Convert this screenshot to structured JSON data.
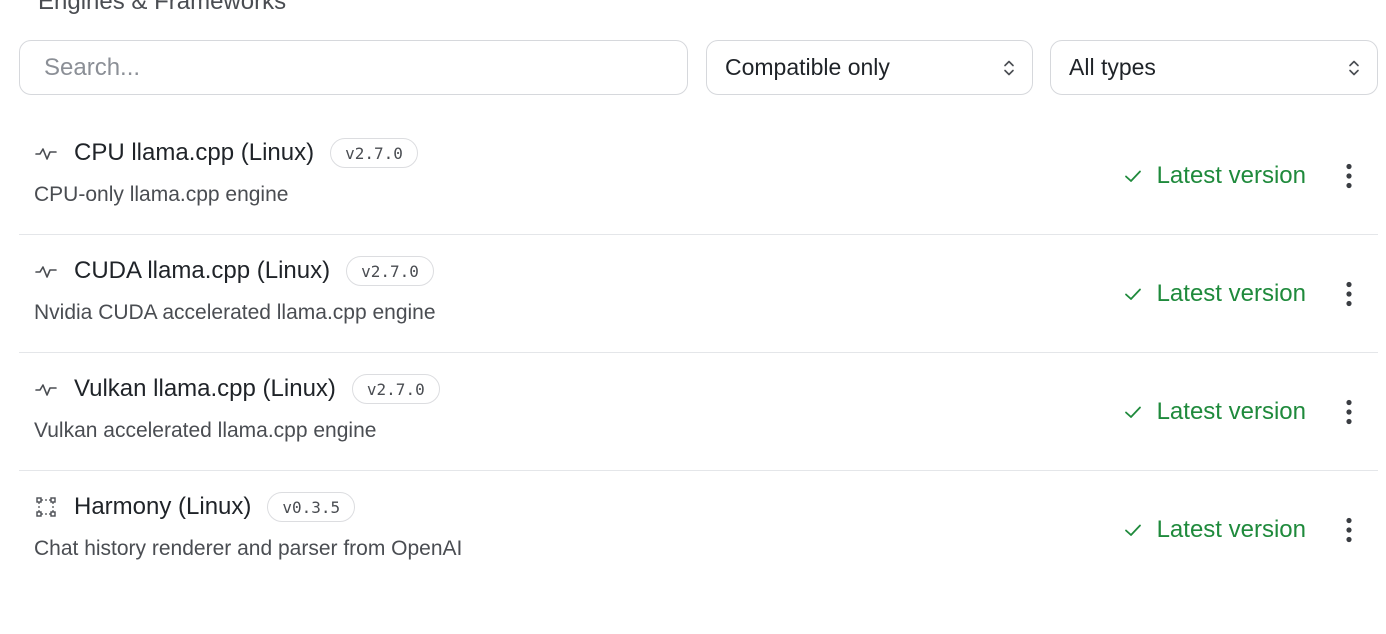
{
  "section_title": "Engines & Frameworks",
  "search": {
    "placeholder": "Search...",
    "value": ""
  },
  "filters": {
    "compatibility": {
      "selected": "Compatible only"
    },
    "type": {
      "selected": "All types"
    }
  },
  "colors": {
    "success": "#1f8a3c",
    "border": "#d6d8dc"
  },
  "engines": [
    {
      "name": "CPU llama.cpp (Linux)",
      "version": "v2.7.0",
      "description": "CPU-only llama.cpp engine",
      "status": "Latest version",
      "icon": "activity-icon"
    },
    {
      "name": "CUDA llama.cpp (Linux)",
      "version": "v2.7.0",
      "description": "Nvidia CUDA accelerated llama.cpp engine",
      "status": "Latest version",
      "icon": "activity-icon"
    },
    {
      "name": "Vulkan llama.cpp (Linux)",
      "version": "v2.7.0",
      "description": "Vulkan accelerated llama.cpp engine",
      "status": "Latest version",
      "icon": "activity-icon"
    },
    {
      "name": "Harmony (Linux)",
      "version": "v0.3.5",
      "description": "Chat history renderer and parser from OpenAI",
      "status": "Latest version",
      "icon": "framework-icon"
    }
  ]
}
